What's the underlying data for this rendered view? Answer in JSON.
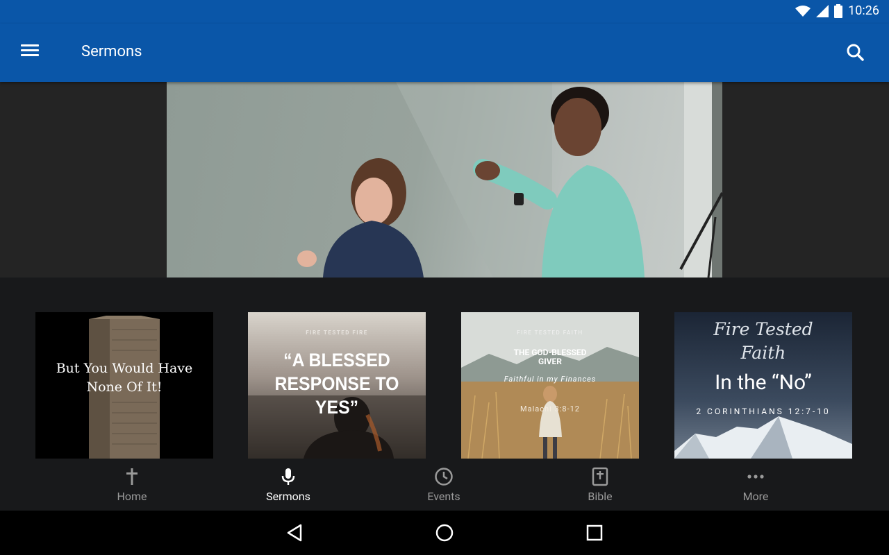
{
  "status": {
    "time": "10:26"
  },
  "appbar": {
    "title": "Sermons"
  },
  "sermons": [
    {
      "title": "But You Would Have None Of It!"
    },
    {
      "series": "FIRE TESTED FIRE",
      "title": "“A BLESSED RESPONSE TO YES”"
    },
    {
      "series": "FIRE TESTED FAITH",
      "title": "THE GOD-BLESSED GIVER",
      "subtitle": "Faithful in my Finances",
      "reference": "Malachi 3:8-12"
    },
    {
      "series": "Fire Tested Faith",
      "title": "In the “No”",
      "reference": "2 CORINTHIANS 12:7-10"
    }
  ],
  "nav": [
    {
      "label": "Home",
      "icon": "cross-icon"
    },
    {
      "label": "Sermons",
      "icon": "microphone-icon"
    },
    {
      "label": "Events",
      "icon": "clock-icon"
    },
    {
      "label": "Bible",
      "icon": "bible-icon"
    },
    {
      "label": "More",
      "icon": "more-icon"
    }
  ],
  "colors": {
    "primary": "#0a56a8",
    "background": "#18191b",
    "nav_active": "#ffffff",
    "nav_inactive": "#9a9a9a"
  }
}
